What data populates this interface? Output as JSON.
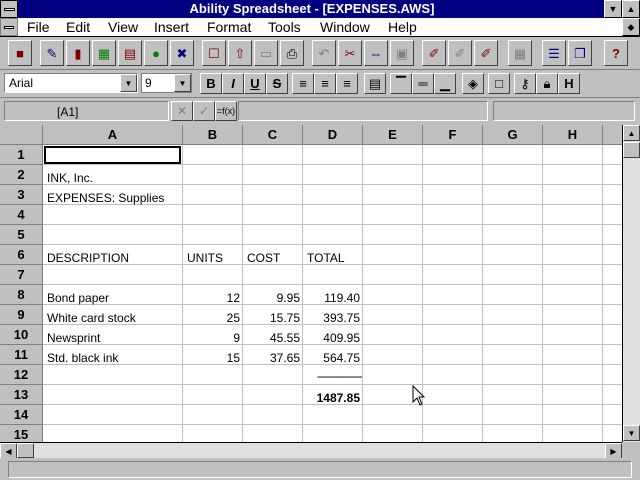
{
  "window": {
    "title": "Ability Spreadsheet - [EXPENSES.AWS]"
  },
  "menu": [
    "File",
    "Edit",
    "View",
    "Insert",
    "Format",
    "Tools",
    "Window",
    "Help"
  ],
  "font": {
    "name": "Arial",
    "size": "9"
  },
  "format_buttons": [
    "B",
    "I",
    "U",
    "S"
  ],
  "formula": {
    "cell_ref": "[A1]",
    "cancel": "✕",
    "accept": "✓",
    "fx": "=f(x)",
    "content": ""
  },
  "columns": [
    "A",
    "B",
    "C",
    "D",
    "E",
    "F",
    "G",
    "H"
  ],
  "rows": [
    "1",
    "2",
    "3",
    "4",
    "5",
    "6",
    "7",
    "8",
    "9",
    "10",
    "11",
    "12",
    "13",
    "14",
    "15"
  ],
  "cells": {
    "A2": "INK, Inc.",
    "A3": "EXPENSES:  Supplies",
    "A6": "DESCRIPTION",
    "B6": "UNITS",
    "C6": "COST",
    "D6": "TOTAL",
    "A8": "Bond paper",
    "B8": "12",
    "C8": "9.95",
    "D8": "119.40",
    "A9": "White card stock",
    "B9": "25",
    "C9": "15.75",
    "D9": "393.75",
    "A10": "Newsprint",
    "B10": "9",
    "C10": "45.55",
    "D10": "409.95",
    "A11": "Std. black ink",
    "B11": "15",
    "C11": "37.65",
    "D11": "564.75",
    "D12": "---------------",
    "D13": "1487.85"
  },
  "selected_cell": "A1"
}
